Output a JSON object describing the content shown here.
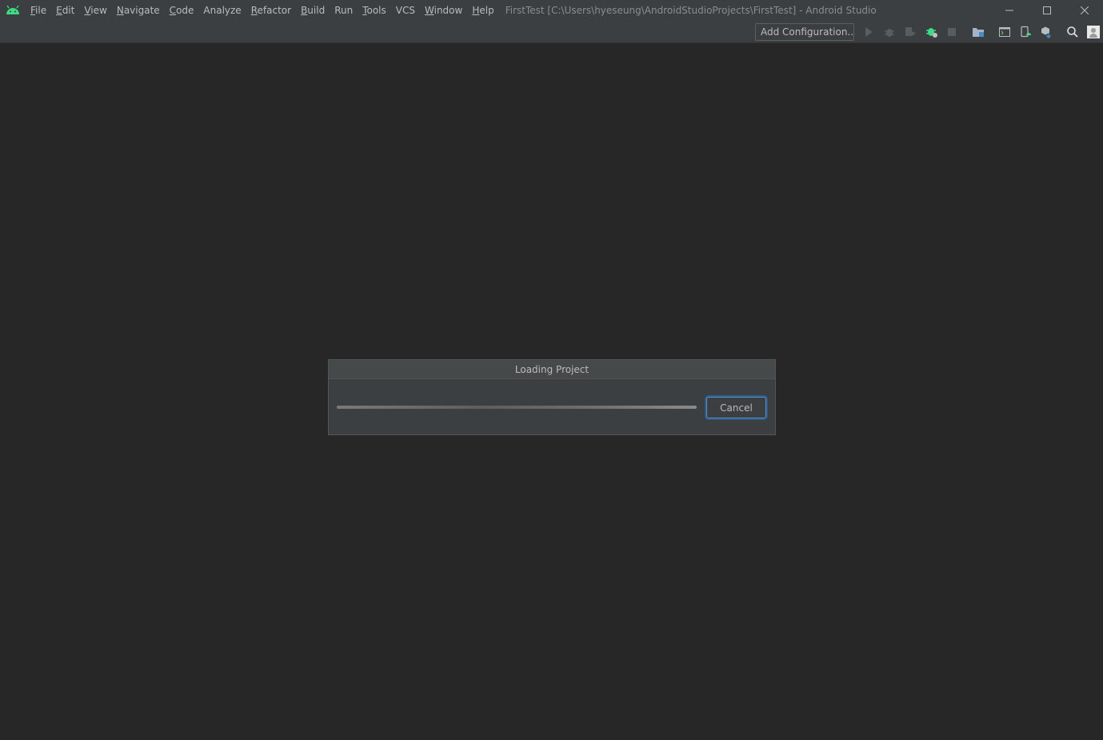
{
  "titlebar": {
    "logo_icon": "android-icon",
    "menu": [
      {
        "mnemonic": "F",
        "rest": "ile"
      },
      {
        "mnemonic": "E",
        "rest": "dit"
      },
      {
        "mnemonic": "V",
        "rest": "iew"
      },
      {
        "mnemonic": "N",
        "rest": "avigate"
      },
      {
        "mnemonic": "C",
        "rest": "ode"
      },
      {
        "mnemonic": "",
        "rest": "Analyze"
      },
      {
        "mnemonic": "R",
        "rest": "efactor"
      },
      {
        "mnemonic": "B",
        "rest": "uild"
      },
      {
        "mnemonic": "",
        "rest": "Run"
      },
      {
        "mnemonic": "T",
        "rest": "ools"
      },
      {
        "mnemonic": "",
        "rest": "VCS"
      },
      {
        "mnemonic": "W",
        "rest": "indow"
      },
      {
        "mnemonic": "H",
        "rest": "elp"
      }
    ],
    "window_title": "FirstTest [C:\\Users\\hyeseung\\AndroidStudioProjects\\FirstTest] - Android Studio"
  },
  "toolbar": {
    "add_configuration": "Add Configuration...",
    "icons": [
      "run-icon",
      "debug-icon",
      "attach-debugger-icon",
      "apply-changes-icon",
      "stop-icon",
      "project-structure-icon",
      "terminal-icon",
      "device-manager-icon",
      "sdk-manager-icon",
      "search-icon",
      "user-icon"
    ]
  },
  "dialog": {
    "title": "Loading Project",
    "cancel_label": "Cancel",
    "progress": 1.0
  },
  "colors": {
    "background": "#272727",
    "chrome": "#3c3f41",
    "accent_android": "#3ddc84",
    "focus_border": "#5a91c4"
  }
}
